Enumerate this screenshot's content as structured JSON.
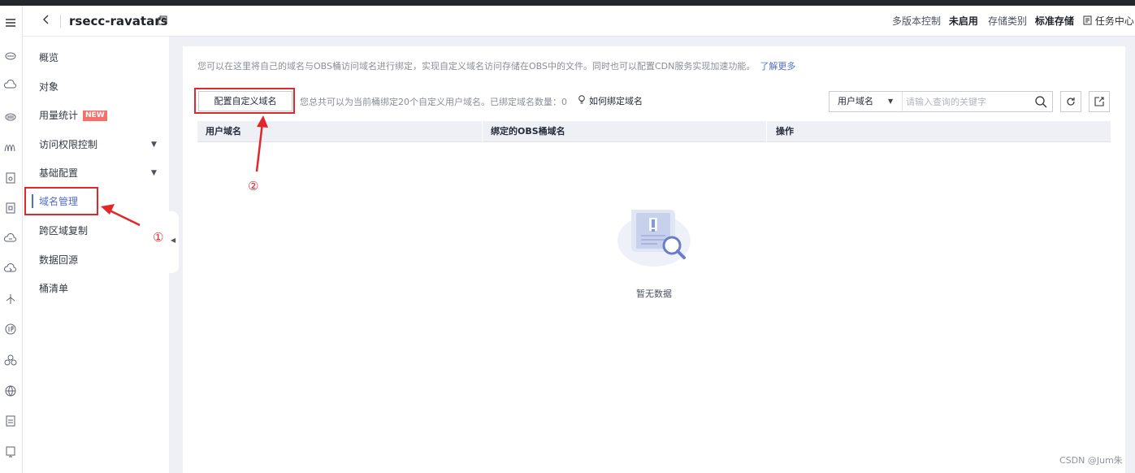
{
  "header": {
    "bucket_name": "rsecc-ravatars",
    "versioning_label": "多版本控制",
    "versioning_value": "未启用",
    "storage_label": "存储类别",
    "storage_value": "标准存储",
    "task_center": "任务中心"
  },
  "sidebar": {
    "items": [
      {
        "label": "概览"
      },
      {
        "label": "对象"
      },
      {
        "label": "用量统计",
        "badge": "NEW"
      },
      {
        "label": "访问权限控制"
      },
      {
        "label": "基础配置"
      },
      {
        "label": "域名管理"
      },
      {
        "label": "跨区域复制"
      },
      {
        "label": "数据回源"
      },
      {
        "label": "桶清单"
      }
    ]
  },
  "main": {
    "description": "您可以在这里将自己的域名与OBS桶访问域名进行绑定，实现自定义域名访问存储在OBS中的文件。同时也可以配置CDN服务实现加速功能。",
    "learn_more": "了解更多",
    "config_button": "配置自定义域名",
    "quota_text": "您总共可以为当前桶绑定20个自定义用户域名。已绑定域名数量：0",
    "howto_link": "如何绑定域名",
    "search": {
      "select_value": "用户域名",
      "placeholder": "请输入查询的关键字"
    },
    "table": {
      "columns": [
        "用户域名",
        "绑定的OBS桶域名",
        "操作"
      ]
    },
    "empty_text": "暂无数据"
  },
  "annotations": {
    "step1": "①",
    "step2": "②",
    "color": "#e0282a"
  },
  "watermark": "CSDN @Jum朱",
  "colors": {
    "accent": "#526ecc",
    "badge": "#f66f6a",
    "annotation": "#e0282a"
  }
}
